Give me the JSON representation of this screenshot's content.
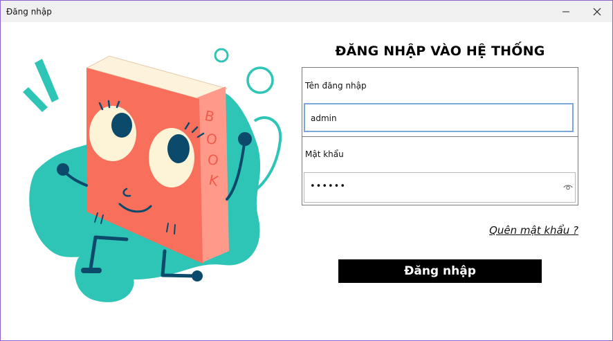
{
  "window": {
    "title": "Đăng nhập",
    "minimize_glyph": "—",
    "close_glyph": "✕"
  },
  "form": {
    "heading": "ĐĂNG NHẬP VÀO HỆ THỐNG",
    "username_label": "Tên đăng nhập",
    "username_value": "admin",
    "password_label": "Mật khẩu",
    "password_value": "••••••",
    "forgot_link": "Quên mật khẩu ?",
    "login_button": "Đăng nhập"
  },
  "illustration": {
    "book_spine_text": [
      "B",
      "O",
      "O",
      "K"
    ]
  },
  "colors": {
    "accent_teal": "#2ec4b6",
    "book_coral": "#f86f5c",
    "button_bg": "#000000",
    "focus_border": "#7ba7d8"
  },
  "icons": [
    "minimize-icon",
    "close-icon",
    "eye-icon"
  ]
}
